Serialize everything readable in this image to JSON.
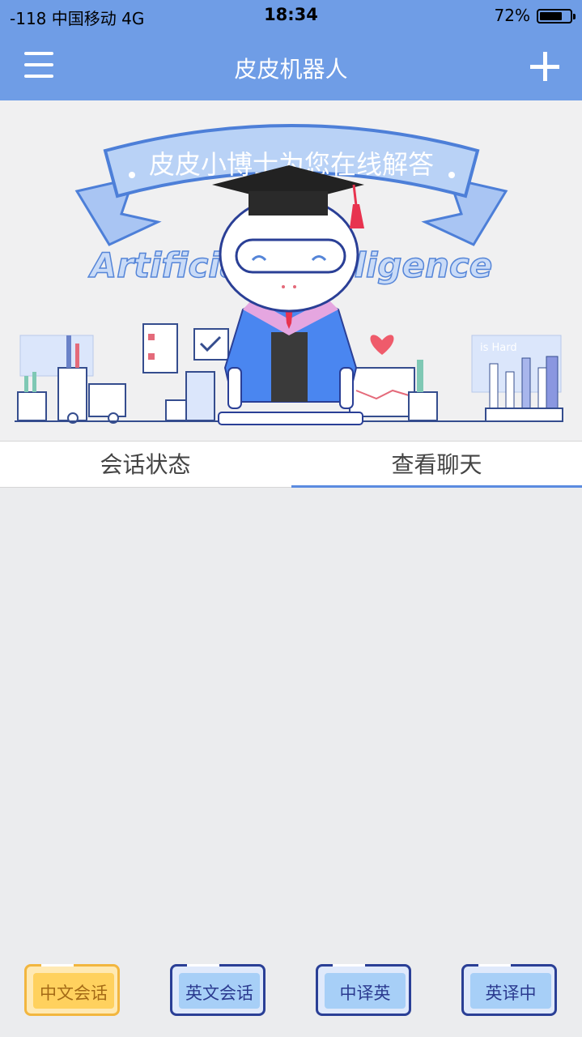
{
  "status_bar": {
    "carrier": "-118 中国移动   4G",
    "time": "18:34",
    "battery_percent": "72%",
    "battery_level": 0.72
  },
  "nav": {
    "title": "皮皮机器人",
    "menu_icon": "hamburger-menu-icon",
    "add_icon": "plus-icon"
  },
  "banner": {
    "ribbon_text": "皮皮小博士为您在线解答",
    "artwork_text": "Artificial Intelligence",
    "side_text": "is Hard"
  },
  "tabs": [
    {
      "label": "会话状态",
      "selected": false
    },
    {
      "label": "查看聊天",
      "selected": true
    }
  ],
  "buttons": [
    {
      "label": "中文会话",
      "style": "yellow"
    },
    {
      "label": "英文会话",
      "style": "blue"
    },
    {
      "label": "中译英",
      "style": "blue"
    },
    {
      "label": "英译中",
      "style": "blue"
    }
  ],
  "colors": {
    "header": "#6f9de6",
    "accent": "#5b8be0",
    "background": "#ebecee"
  }
}
